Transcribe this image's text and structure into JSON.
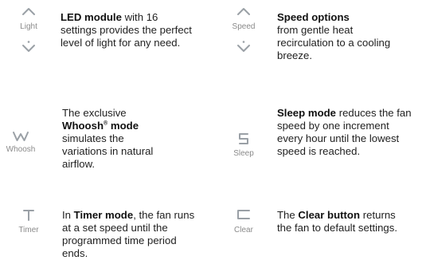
{
  "features": {
    "light": {
      "icon_label": "Light",
      "up_icon": "chevron-up-icon",
      "down_icon": "chevron-down-dot-icon",
      "title": "LED module",
      "text": " with 16 settings provides the perfect level of light for any need."
    },
    "speed": {
      "icon_label": "Speed",
      "up_icon": "chevron-up-icon",
      "down_icon": "chevron-down-dot-icon",
      "title": "Speed options",
      "text": "from gentle heat recirculation to a cooling breeze."
    },
    "whoosh": {
      "icon_label": "Whoosh",
      "icon": "whoosh-w-icon",
      "text_before": "The exclusive ",
      "title": "Whoosh",
      "trademark": "®",
      "title_suffix": " mode",
      "text": "simulates the variations in natural airflow."
    },
    "sleep": {
      "icon_label": "Sleep",
      "icon": "sleep-s-icon",
      "title": "Sleep mode",
      "text": " reduces the fan speed by one increment every hour until the lowest speed is reached."
    },
    "timer": {
      "icon_label": "Timer",
      "icon": "timer-t-icon",
      "text_before": "In ",
      "title": "Timer mode",
      "text": ", the fan runs at a set speed until the programmed time period ends."
    },
    "clear": {
      "icon_label": "Clear",
      "icon": "clear-bracket-icon",
      "text_before": "The ",
      "title": "Clear button",
      "text": " returns the fan to default settings."
    }
  },
  "colors": {
    "icon": "#9aa0a6",
    "label": "#8a8a8a",
    "text": "#1f1f1f"
  }
}
